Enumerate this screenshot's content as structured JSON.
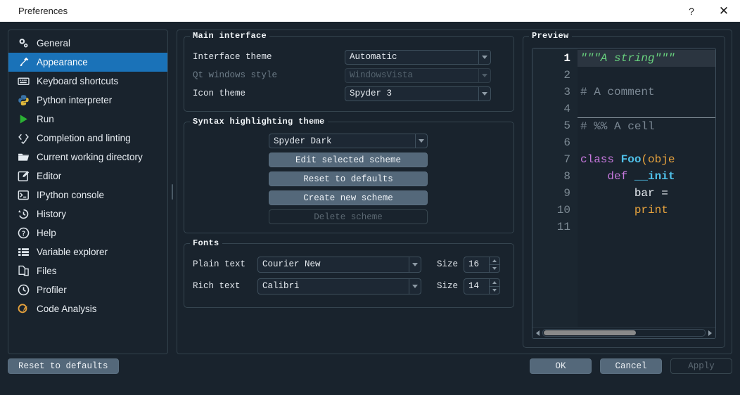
{
  "window": {
    "title": "Preferences",
    "help_button": "?",
    "close_button": "✕"
  },
  "sidebar": {
    "items": [
      {
        "label": "General",
        "icon": "gears-icon",
        "selected": false
      },
      {
        "label": "Appearance",
        "icon": "eyedropper-icon",
        "selected": true
      },
      {
        "label": "Keyboard shortcuts",
        "icon": "keyboard-icon",
        "selected": false
      },
      {
        "label": "Python interpreter",
        "icon": "python-icon",
        "selected": false
      },
      {
        "label": "Run",
        "icon": "play-icon",
        "selected": false
      },
      {
        "label": "Completion and linting",
        "icon": "code-check-icon",
        "selected": false
      },
      {
        "label": "Current working directory",
        "icon": "folder-open-icon",
        "selected": false
      },
      {
        "label": "Editor",
        "icon": "pencil-square-icon",
        "selected": false
      },
      {
        "label": "IPython console",
        "icon": "terminal-icon",
        "selected": false
      },
      {
        "label": "History",
        "icon": "history-icon",
        "selected": false
      },
      {
        "label": "Help",
        "icon": "question-circle-icon",
        "selected": false
      },
      {
        "label": "Variable explorer",
        "icon": "list-icon",
        "selected": false
      },
      {
        "label": "Files",
        "icon": "files-icon",
        "selected": false
      },
      {
        "label": "Profiler",
        "icon": "clock-icon",
        "selected": false
      },
      {
        "label": "Code Analysis",
        "icon": "check-warning-icon",
        "selected": false
      }
    ]
  },
  "main_interface": {
    "title": "Main interface",
    "rows": [
      {
        "label": "Interface theme",
        "value": "Automatic",
        "disabled": false
      },
      {
        "label": "Qt windows style",
        "value": "WindowsVista",
        "disabled": true
      },
      {
        "label": "Icon theme",
        "value": "Spyder 3",
        "disabled": false
      }
    ]
  },
  "syntax_theme": {
    "title": "Syntax highlighting theme",
    "selected_scheme": "Spyder Dark",
    "buttons": [
      {
        "label": "Edit selected scheme",
        "disabled": false
      },
      {
        "label": "Reset to defaults",
        "disabled": false
      },
      {
        "label": "Create new scheme",
        "disabled": false
      },
      {
        "label": "Delete scheme",
        "disabled": true
      }
    ]
  },
  "fonts": {
    "title": "Fonts",
    "rows": [
      {
        "label": "Plain text",
        "font": "Courier New",
        "size_label": "Size",
        "size": "16"
      },
      {
        "label": "Rich text",
        "font": "Calibri",
        "size_label": "Size",
        "size": "14"
      }
    ]
  },
  "preview": {
    "title": "Preview",
    "line_numbers": [
      "1",
      "2",
      "3",
      "4",
      "5",
      "6",
      "7",
      "8",
      "9",
      "10",
      "11"
    ],
    "current_line": 1,
    "cell_separator_before_line": 5,
    "lines": [
      {
        "n": 1,
        "tokens": [
          {
            "t": "\"\"\"A string\"\"\"",
            "c": "tok-str"
          }
        ]
      },
      {
        "n": 2,
        "tokens": []
      },
      {
        "n": 3,
        "tokens": [
          {
            "t": "# A comment",
            "c": "tok-com"
          }
        ]
      },
      {
        "n": 4,
        "tokens": []
      },
      {
        "n": 5,
        "tokens": [
          {
            "t": "# %% A cell",
            "c": "tok-com"
          }
        ]
      },
      {
        "n": 6,
        "tokens": []
      },
      {
        "n": 7,
        "tokens": [
          {
            "t": "class ",
            "c": "tok-kw"
          },
          {
            "t": "Foo",
            "c": "tok-cls"
          },
          {
            "t": "(obje",
            "c": "tok-bi"
          }
        ]
      },
      {
        "n": 8,
        "tokens": [
          {
            "t": "    ",
            "c": "tok-norm"
          },
          {
            "t": "def ",
            "c": "tok-kw"
          },
          {
            "t": "__init",
            "c": "tok-fn"
          }
        ]
      },
      {
        "n": 9,
        "tokens": [
          {
            "t": "        bar = ",
            "c": "tok-norm"
          }
        ]
      },
      {
        "n": 10,
        "tokens": [
          {
            "t": "        ",
            "c": "tok-norm"
          },
          {
            "t": "print",
            "c": "tok-bi"
          }
        ]
      },
      {
        "n": 11,
        "tokens": []
      }
    ],
    "hscroll": {
      "thumb_percent": 57
    }
  },
  "footer": {
    "reset_label": "Reset to defaults",
    "ok_label": "OK",
    "cancel_label": "Cancel",
    "apply_label": "Apply",
    "apply_disabled": true
  },
  "colors": {
    "window_bg": "#19232d",
    "accent_selection": "#1a72b8",
    "group_border": "#35444f",
    "button_bg": "#54687a",
    "string": "#68d17e",
    "comment": "#7b8894",
    "keyword": "#c678dd",
    "class": "#4fc1e9",
    "builtin": "#e8a33d"
  }
}
